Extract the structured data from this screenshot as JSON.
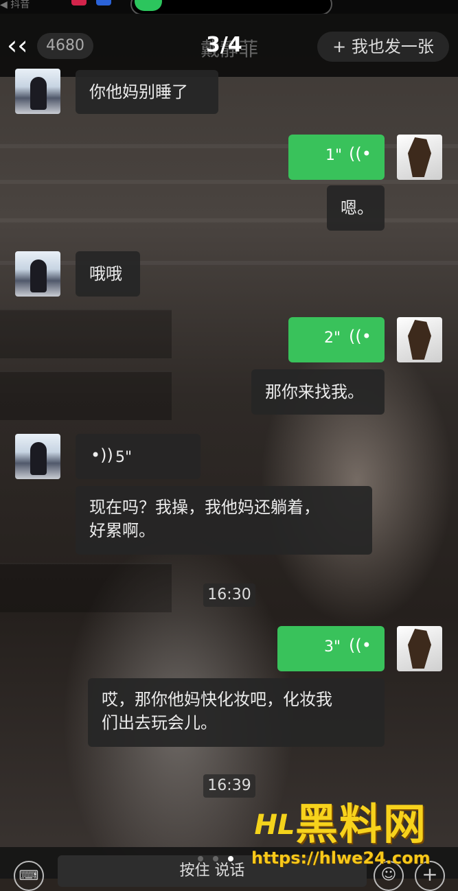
{
  "status": {
    "left_text": "◀ 抖音"
  },
  "header": {
    "back_icon": "‹‹",
    "unread_count": "4680",
    "contact_name": "戴",
    "contact_name_rest": "靜菲",
    "page_indicator": "3/4",
    "post_button": "+ 我也发一张"
  },
  "messages": [
    {
      "side": "left",
      "type": "text",
      "text": "你他妈别睡了"
    },
    {
      "side": "right",
      "type": "voice",
      "duration": "1\""
    },
    {
      "side": "right",
      "type": "text",
      "text": "嗯。"
    },
    {
      "side": "left",
      "type": "text",
      "text": "哦哦"
    },
    {
      "side": "right",
      "type": "voice",
      "duration": "2\""
    },
    {
      "side": "right",
      "type": "text",
      "text": "那你来找我。"
    },
    {
      "side": "left",
      "type": "voice",
      "duration": "5\""
    },
    {
      "side": "left",
      "type": "text",
      "text_line1": "现在吗？我操，我他妈还躺着，",
      "text_line2": "好累啊。"
    },
    {
      "type": "time",
      "text": "16:30"
    },
    {
      "side": "right",
      "type": "voice",
      "duration": "3\""
    },
    {
      "side": "right",
      "type": "text",
      "text_line1": "哎，那你他妈快化妆吧，化妆我",
      "text_line2": "们出去玩会儿。"
    },
    {
      "type": "time",
      "text": "16:39"
    }
  ],
  "input_bar": {
    "keyboard_icon": "⌨",
    "hold_to_talk": "按住 说话",
    "emoji_icon": "☺",
    "plus_icon": "+"
  },
  "pager": {
    "total": 3,
    "active": 2
  },
  "watermark": {
    "logo": "HL",
    "title": "黑料网",
    "url": "https://hlwe24.com"
  },
  "colors": {
    "green": "#39c25b",
    "watermark": "#f7d21c"
  }
}
